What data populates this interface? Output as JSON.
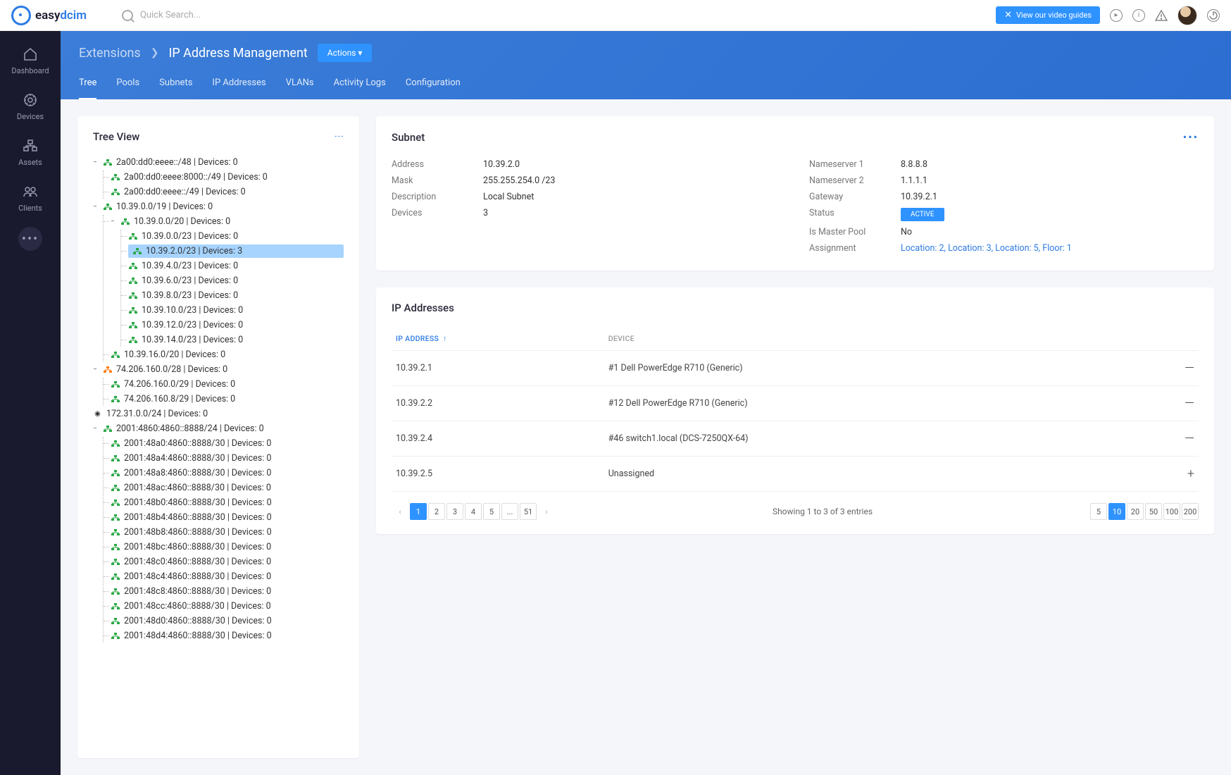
{
  "header": {
    "logo_easy": "easy",
    "logo_dcim": "dcim",
    "search_placeholder": "Quick Search...",
    "video_guides": "View our video guides"
  },
  "sidebar": {
    "items": [
      "Dashboard",
      "Devices",
      "Assets",
      "Clients"
    ]
  },
  "breadcrumb": {
    "parent": "Extensions",
    "current": "IP Address Management",
    "action_btn": "Actions"
  },
  "tabs": [
    "Tree",
    "Pools",
    "Subnets",
    "IP Addresses",
    "VLANs",
    "Activity Logs",
    "Configuration"
  ],
  "tree_title": "Tree View",
  "tree": [
    {
      "icon": "green",
      "toggle": "-",
      "label": "2a00:dd0:eeee::/48 | Devices: 0",
      "children": [
        {
          "icon": "green",
          "label": "2a00:dd0:eeee:8000::/49 | Devices: 0"
        },
        {
          "icon": "green",
          "label": "2a00:dd0:eeee::/49 | Devices: 0"
        }
      ]
    },
    {
      "icon": "green",
      "toggle": "-",
      "label": "10.39.0.0/19 | Devices: 0",
      "children": [
        {
          "icon": "green",
          "toggle": "-",
          "label": "10.39.0.0/20 | Devices: 0",
          "children": [
            {
              "icon": "green",
              "label": "10.39.0.0/23 | Devices: 0"
            },
            {
              "icon": "green",
              "label": "10.39.2.0/23 | Devices: 3",
              "selected": true
            },
            {
              "icon": "green",
              "label": "10.39.4.0/23 | Devices: 0"
            },
            {
              "icon": "green",
              "label": "10.39.6.0/23 | Devices: 0"
            },
            {
              "icon": "green",
              "label": "10.39.8.0/23 | Devices: 0"
            },
            {
              "icon": "green",
              "label": "10.39.10.0/23 | Devices: 0"
            },
            {
              "icon": "green",
              "label": "10.39.12.0/23 | Devices: 0"
            },
            {
              "icon": "green",
              "label": "10.39.14.0/23 | Devices: 0"
            }
          ]
        },
        {
          "icon": "green",
          "label": "10.39.16.0/20 | Devices: 0"
        }
      ]
    },
    {
      "icon": "orange",
      "toggle": "-",
      "label": "74.206.160.0/28 | Devices: 0",
      "children": [
        {
          "icon": "green",
          "label": "74.206.160.0/29 | Devices: 0"
        },
        {
          "icon": "green",
          "label": "74.206.160.8/29 | Devices: 0"
        }
      ]
    },
    {
      "icon": "dark",
      "label": "172.31.0.0/24 | Devices: 0"
    },
    {
      "icon": "green",
      "toggle": "-",
      "label": "2001:4860:4860::8888/24 | Devices: 0",
      "children": [
        {
          "icon": "green",
          "label": "2001:48a0:4860::8888/30 | Devices: 0"
        },
        {
          "icon": "green",
          "label": "2001:48a4:4860::8888/30 | Devices: 0"
        },
        {
          "icon": "green",
          "label": "2001:48a8:4860::8888/30 | Devices: 0"
        },
        {
          "icon": "green",
          "label": "2001:48ac:4860::8888/30 | Devices: 0"
        },
        {
          "icon": "green",
          "label": "2001:48b0:4860::8888/30 | Devices: 0"
        },
        {
          "icon": "green",
          "label": "2001:48b4:4860::8888/30 | Devices: 0"
        },
        {
          "icon": "green",
          "label": "2001:48b8:4860::8888/30 | Devices: 0"
        },
        {
          "icon": "green",
          "label": "2001:48bc:4860::8888/30 | Devices: 0"
        },
        {
          "icon": "green",
          "label": "2001:48c0:4860::8888/30 | Devices: 0"
        },
        {
          "icon": "green",
          "label": "2001:48c4:4860::8888/30 | Devices: 0"
        },
        {
          "icon": "green",
          "label": "2001:48c8:4860::8888/30 | Devices: 0"
        },
        {
          "icon": "green",
          "label": "2001:48cc:4860::8888/30 | Devices: 0"
        },
        {
          "icon": "green",
          "label": "2001:48d0:4860::8888/30 | Devices: 0"
        },
        {
          "icon": "green",
          "label": "2001:48d4:4860::8888/30 | Devices: 0"
        }
      ]
    }
  ],
  "subnet": {
    "title": "Subnet",
    "left": [
      {
        "label": "Address",
        "value": "10.39.2.0"
      },
      {
        "label": "Mask",
        "value": "255.255.254.0 /23"
      },
      {
        "label": "Description",
        "value": "Local Subnet"
      },
      {
        "label": "Devices",
        "value": "3"
      }
    ],
    "right": [
      {
        "label": "Nameserver 1",
        "value": "8.8.8.8"
      },
      {
        "label": "Nameserver 2",
        "value": "1.1.1.1"
      },
      {
        "label": "Gateway",
        "value": "10.39.2.1"
      },
      {
        "label": "Status",
        "value": "ACTIVE",
        "badge": true
      },
      {
        "label": "Is Master Pool",
        "value": "No"
      },
      {
        "label": "Assignment",
        "value": "Location: 2, Location: 3, Location: 5, Floor: 1",
        "link": true
      }
    ]
  },
  "ip_addresses": {
    "title": "IP Addresses",
    "columns": [
      "IP ADDRESS",
      "DEVICE"
    ],
    "rows": [
      {
        "ip": "10.39.2.1",
        "device": "#1 Dell PowerEdge R710 (Generic)",
        "action": "minus"
      },
      {
        "ip": "10.39.2.2",
        "device": "#12 Dell PowerEdge R710 (Generic)",
        "action": "minus"
      },
      {
        "ip": "10.39.2.4",
        "device": "#46 switch1.local (DCS-7250QX-64)",
        "action": "minus"
      },
      {
        "ip": "10.39.2.5",
        "device": "Unassigned",
        "action": "plus"
      }
    ],
    "pages": [
      "1",
      "2",
      "3",
      "4",
      "5",
      "...",
      "51"
    ],
    "showing": "Showing 1 to 3 of 3 entries",
    "sizes": [
      "5",
      "10",
      "20",
      "50",
      "100",
      "200"
    ]
  }
}
